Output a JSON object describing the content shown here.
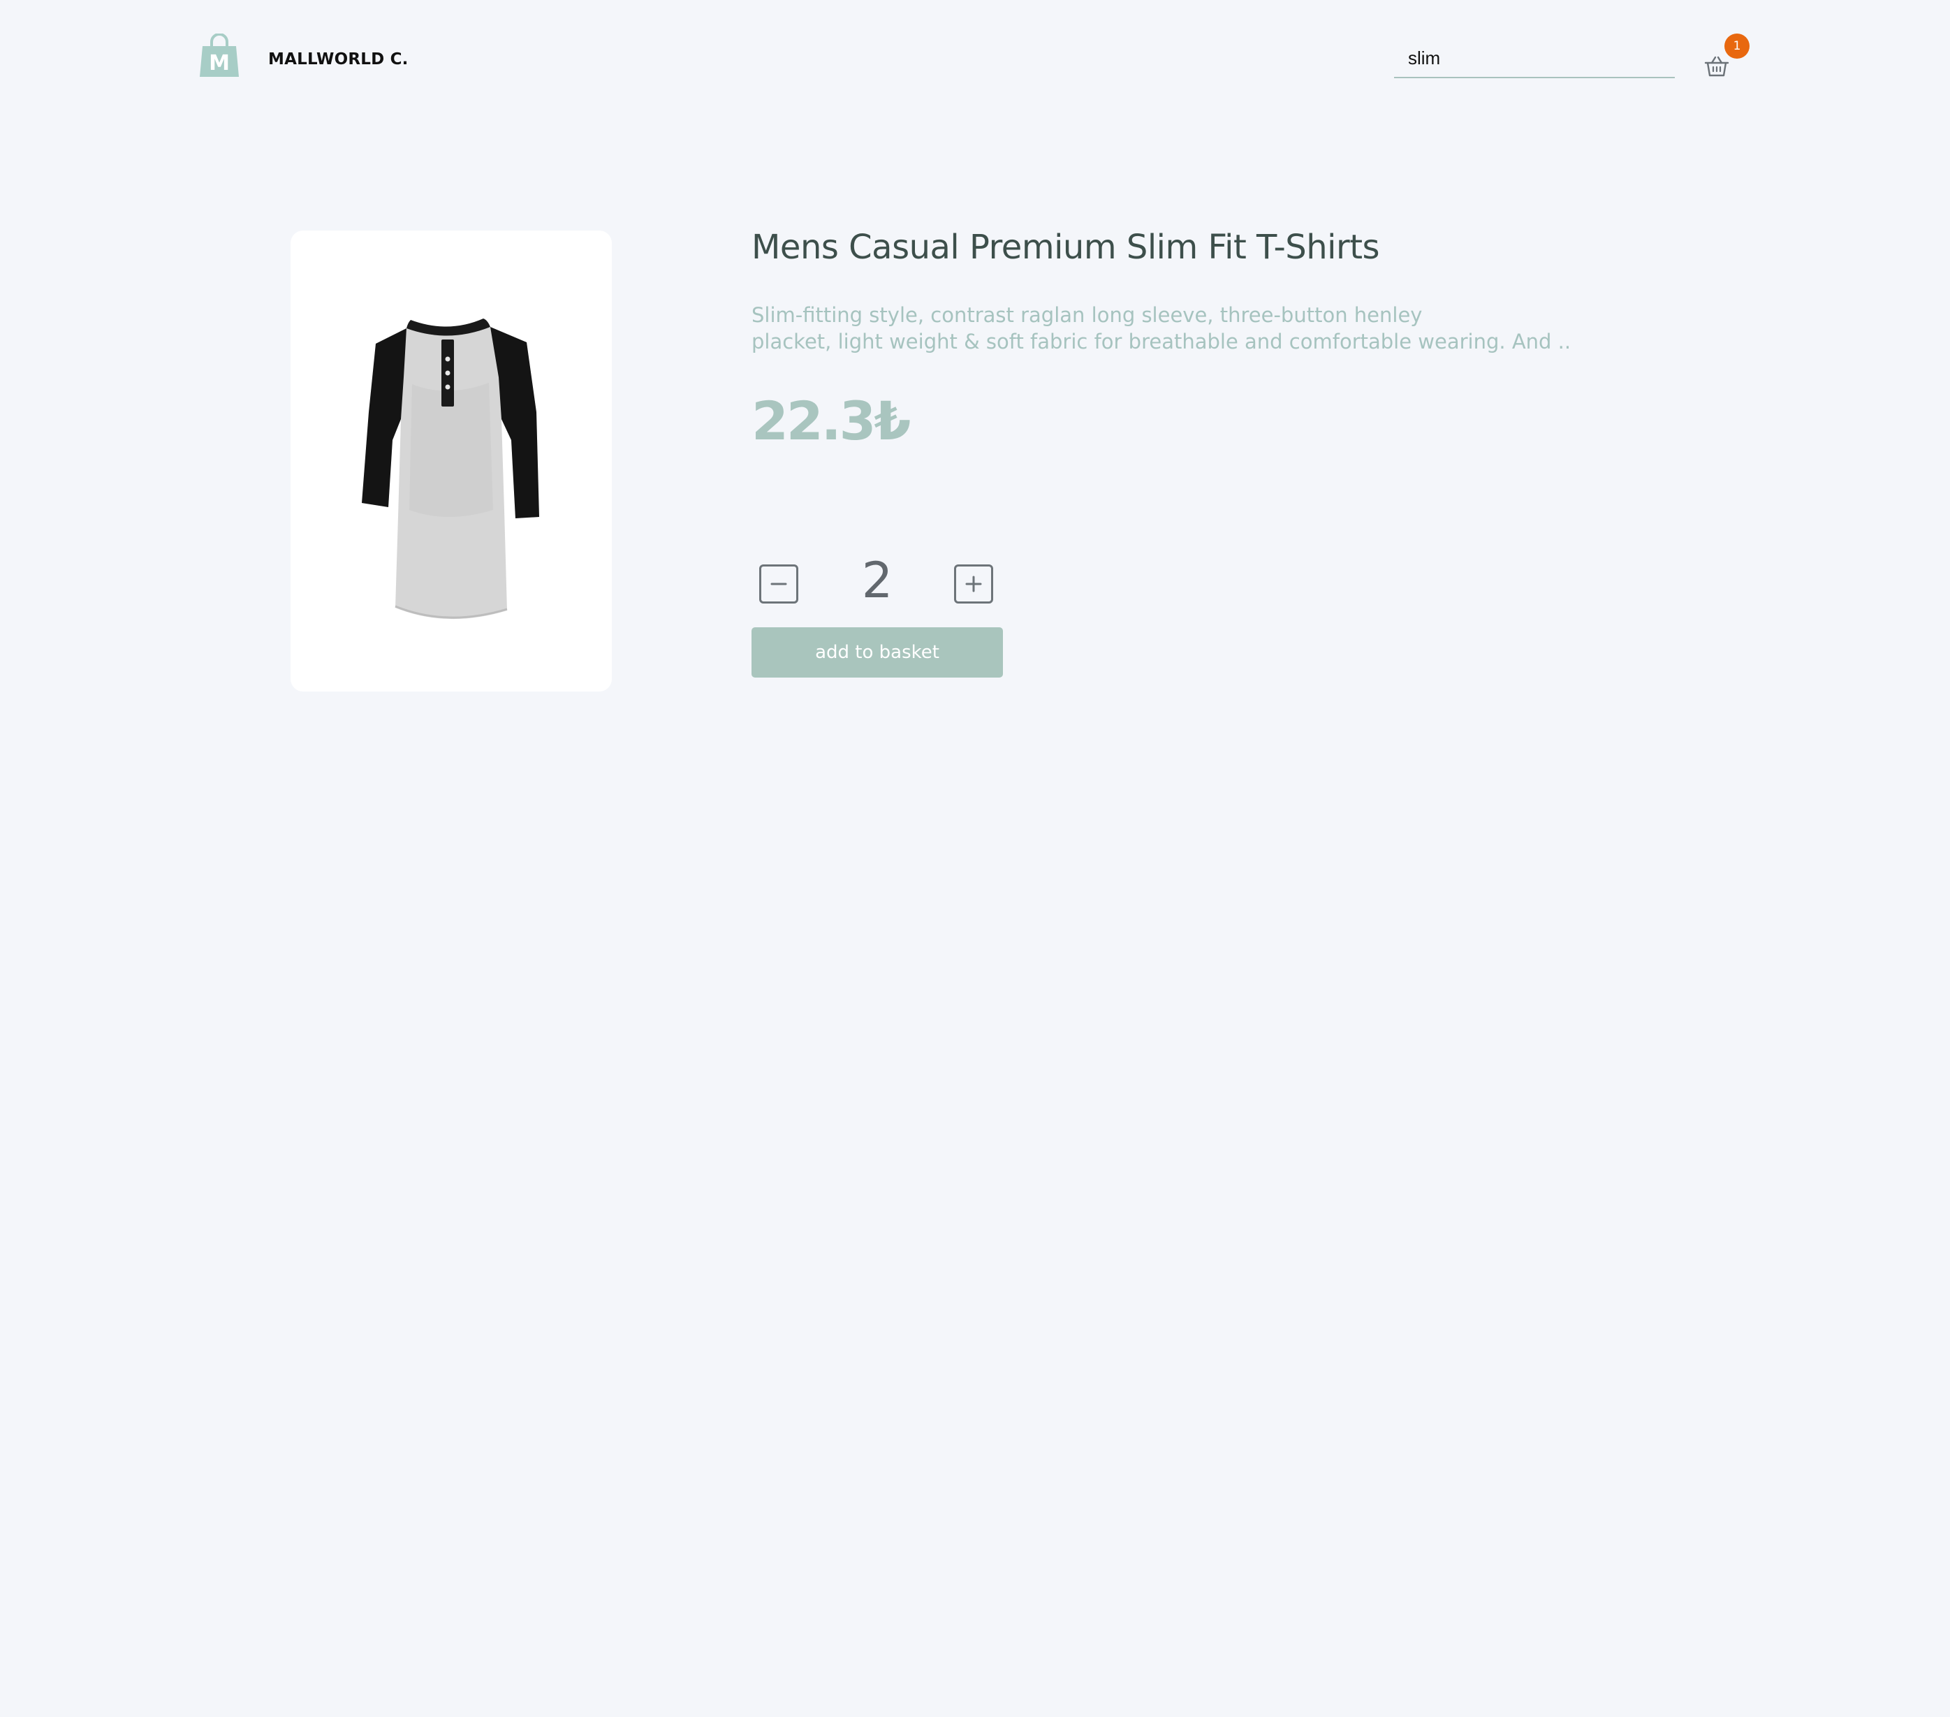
{
  "header": {
    "brand_name": "MALLWORLD C.",
    "logo_letter": "M",
    "logo_icon": "shopping-bag-icon",
    "search": {
      "value": "slim",
      "placeholder": ""
    },
    "basket": {
      "icon": "basket-icon",
      "count": "1"
    }
  },
  "product": {
    "image_alt": "grey raglan henley t-shirt with black sleeves",
    "title": "Mens Casual Premium Slim Fit T-Shirts",
    "description": "Slim-fitting style, contrast raglan long sleeve, three-button henley\nplacket,    light weight & soft fabric for breathable and comfortable wearing. And ..",
    "price": "22.3₺"
  },
  "quantity": {
    "value": "2",
    "minus_icon": "minus-icon",
    "plus_icon": "plus-icon"
  },
  "actions": {
    "add_to_basket_label": "add to basket"
  },
  "colors": {
    "background": "#f4f6fa",
    "accent": "#a9c5bd",
    "badge": "#e8680f",
    "title": "#3d4f4b"
  }
}
